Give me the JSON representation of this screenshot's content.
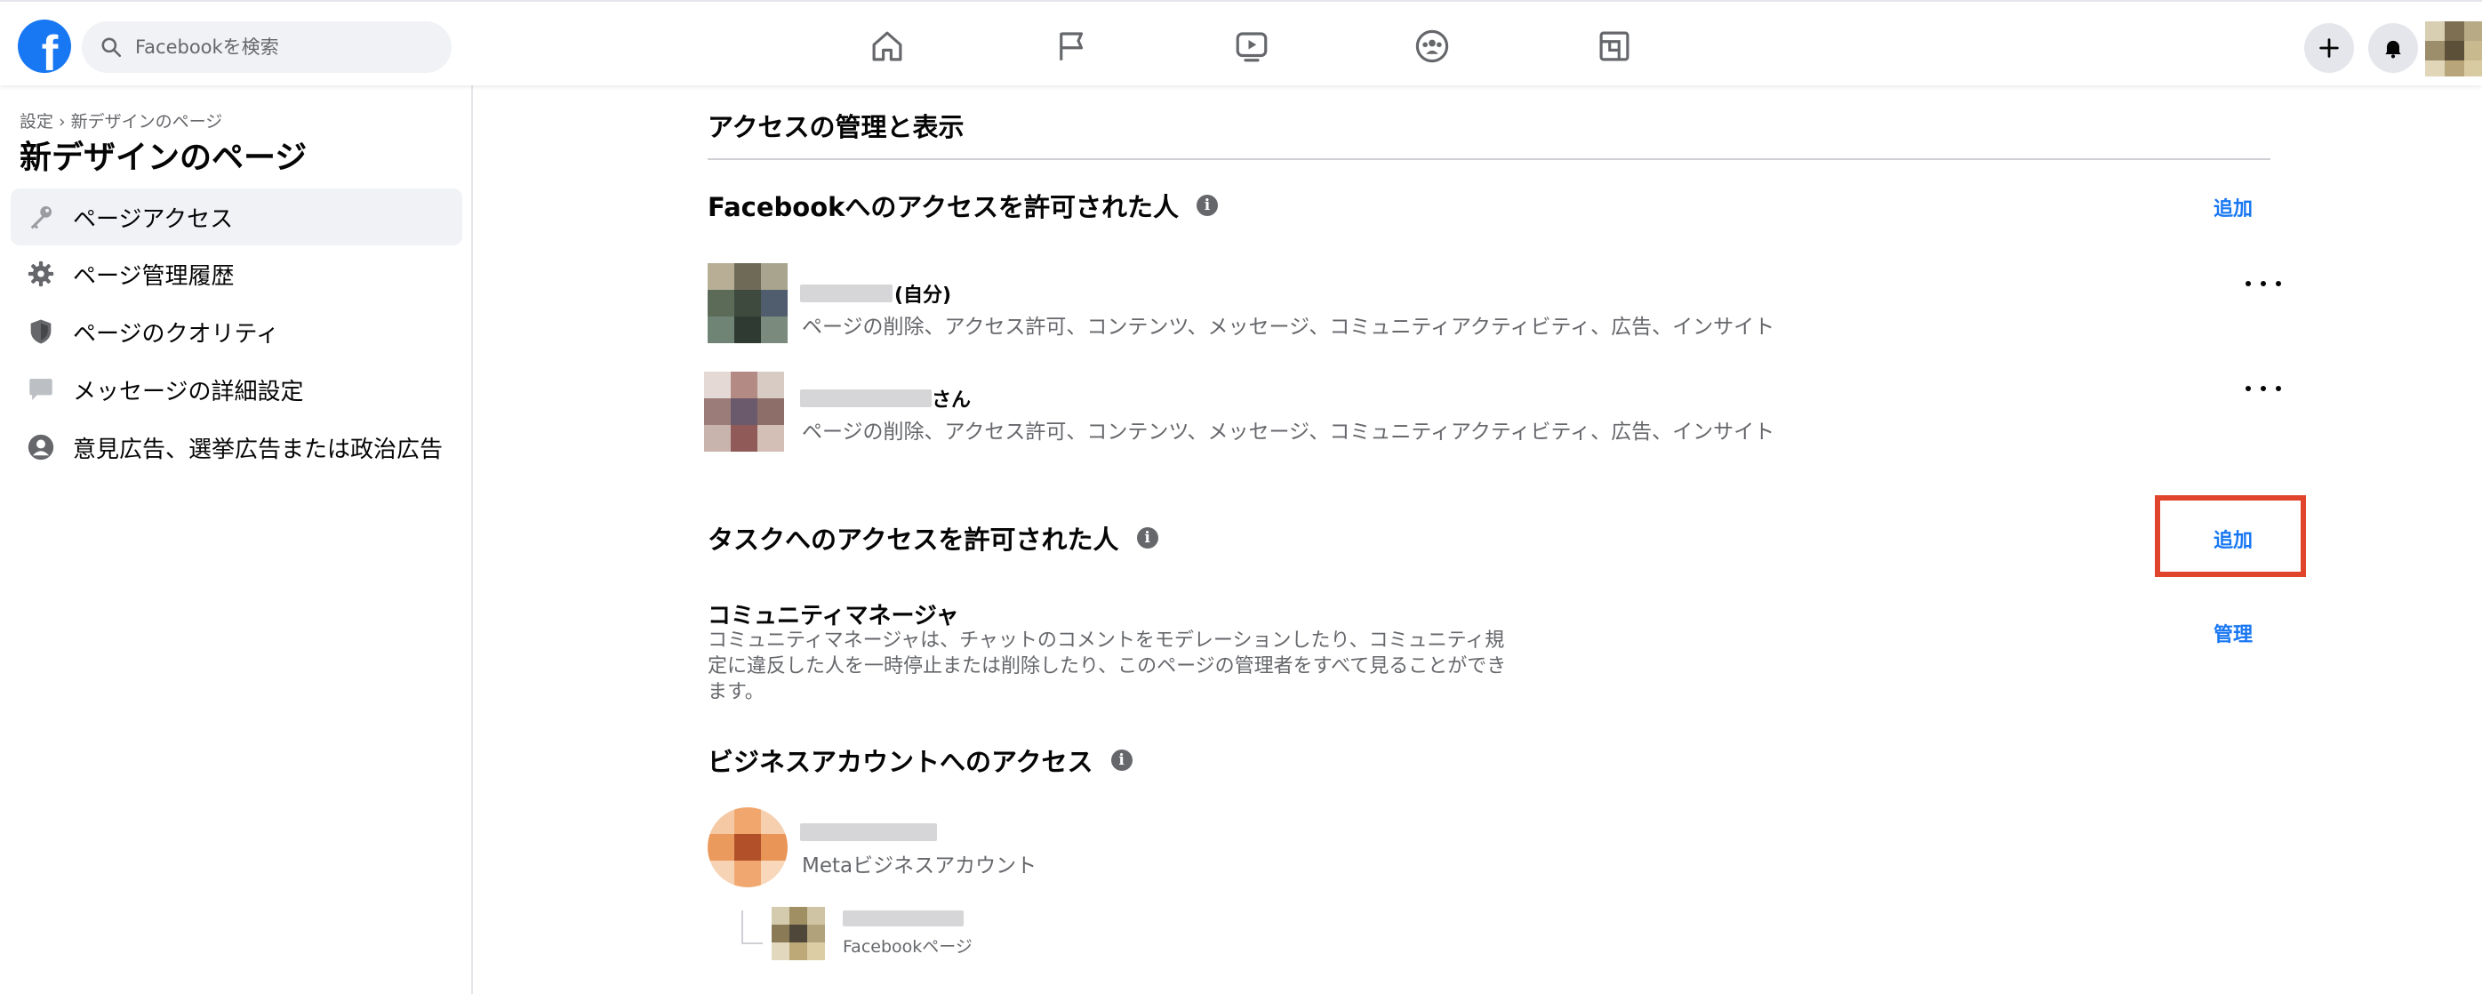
{
  "topbar": {
    "logo_letter": "f",
    "search_placeholder": "Facebookを検索",
    "nav_icons": [
      "home-icon",
      "pages-flag-icon",
      "watch-video-icon",
      "groups-icon",
      "gaming-icon"
    ],
    "right_buttons": [
      "plus-icon",
      "notifications-bell-icon"
    ]
  },
  "sidebar": {
    "breadcrumb": "設定 › 新デザインのページ",
    "title": "新デザインのページ",
    "items": [
      {
        "label": "ページアクセス",
        "icon": "key-icon",
        "active": true
      },
      {
        "label": "ページ管理履歴",
        "icon": "gear-icon",
        "active": false
      },
      {
        "label": "ページのクオリティ",
        "icon": "shield-icon",
        "active": false
      },
      {
        "label": "メッセージの詳細設定",
        "icon": "message-bubble-icon",
        "active": false
      },
      {
        "label": "意見広告、選挙広告または政治広告",
        "icon": "person-circle-icon",
        "active": false
      }
    ]
  },
  "main": {
    "heading": "アクセスの管理と表示",
    "facebook_access": {
      "title": "Facebookへのアクセスを許可された人",
      "add_label": "追加",
      "people": [
        {
          "name_suffix": "(自分)",
          "permissions": "ページの削除、アクセス許可、コンテンツ、メッセージ、コミュニティアクティビティ、広告、インサイト"
        },
        {
          "name_suffix": "さん",
          "permissions": "ページの削除、アクセス許可、コンテンツ、メッセージ、コミュニティアクティビティ、広告、インサイト"
        }
      ]
    },
    "task_access": {
      "title": "タスクへのアクセスを許可された人",
      "add_label": "追加",
      "community_manager": {
        "title": "コミュニティマネージャ",
        "description": "コミュニティマネージャは、チャットのコメントをモデレーションしたり、コミュニティ規定に違反した人を一時停止または削除したり、このページの管理者をすべて見ることができます。",
        "manage_label": "管理"
      }
    },
    "business_access": {
      "title": "ビジネスアカウントへのアクセス",
      "account_type": "Metaビジネスアカウント",
      "page_type": "Facebookページ"
    }
  },
  "colors": {
    "brand_blue": "#1877f2",
    "highlight_red": "#e0452b",
    "secondary_text": "#65676b",
    "hover_bg": "#f0f2f5"
  }
}
